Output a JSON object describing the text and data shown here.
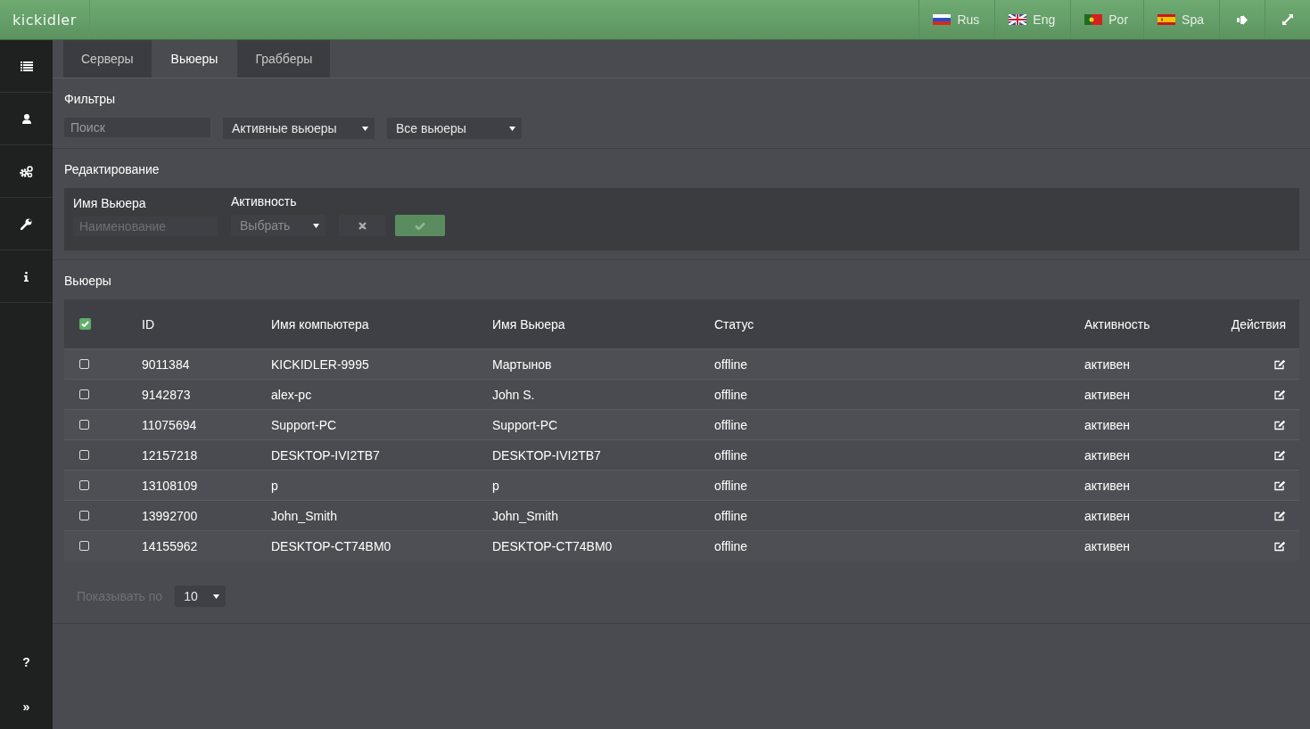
{
  "header": {
    "logo": "kickidler",
    "languages": [
      {
        "kind": "ru",
        "label": "Rus"
      },
      {
        "kind": "gb",
        "label": "Eng"
      },
      {
        "kind": "pt",
        "label": "Por"
      },
      {
        "kind": "es",
        "label": "Spa"
      }
    ]
  },
  "sidebar": {
    "items": [
      {
        "kind": "list"
      },
      {
        "kind": "user"
      },
      {
        "kind": "gears"
      },
      {
        "kind": "wrench"
      },
      {
        "kind": "info"
      }
    ],
    "bottom": [
      "?",
      "»"
    ]
  },
  "tabs": [
    {
      "label": "Серверы",
      "selected": false
    },
    {
      "label": "Вьюеры",
      "selected": true
    },
    {
      "label": "Грабберы",
      "selected": false
    }
  ],
  "filters": {
    "title": "Фильтры",
    "search": {
      "placeholder": "Поиск"
    },
    "selects": [
      "Активные вьюеры",
      "Все вьюеры"
    ]
  },
  "edit": {
    "title": "Редактирование",
    "name_label": "Имя Вьюера",
    "name_placeholder": "Наименование",
    "activity_label": "Активность",
    "activity_select": "Выбрать"
  },
  "table": {
    "title": "Вьюеры",
    "header_checked": true,
    "columns": [
      "ID",
      "Имя компьютера",
      "Имя Вьюера",
      "Статус",
      "Активность",
      "Действия"
    ],
    "rows": [
      {
        "checked": false,
        "cells": [
          "9011384",
          "KICKIDLER-9995",
          "Мартынов",
          "offline",
          "активен"
        ]
      },
      {
        "checked": false,
        "cells": [
          "9142873",
          "alex-pc",
          "John S.",
          "offline",
          "активен"
        ]
      },
      {
        "checked": false,
        "cells": [
          "11075694",
          "Support-PC",
          "Support-PC",
          "offline",
          "активен"
        ]
      },
      {
        "checked": false,
        "cells": [
          "12157218",
          "DESKTOP-IVI2TB7",
          "DESKTOP-IVI2TB7",
          "offline",
          "активен"
        ]
      },
      {
        "checked": false,
        "cells": [
          "13108109",
          "p",
          "p",
          "offline",
          "активен"
        ]
      },
      {
        "checked": false,
        "cells": [
          "13992700",
          "John_Smith",
          "John_Smith",
          "offline",
          "активен"
        ]
      },
      {
        "checked": false,
        "cells": [
          "14155962",
          "DESKTOP-CT74BM0",
          "DESKTOP-CT74BM0",
          "offline",
          "активен"
        ]
      }
    ]
  },
  "pagination": {
    "label": "Показывать по",
    "page_size": "10"
  }
}
